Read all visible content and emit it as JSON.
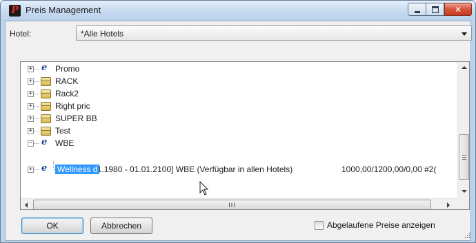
{
  "window": {
    "title": "Preis Management",
    "app_icon_letter": "P",
    "close_glyph": "✕"
  },
  "hotel": {
    "label": "Hotel:",
    "selected": "*Alle Hotels"
  },
  "tree": {
    "items": [
      {
        "label": "Promo",
        "icon": "ie-e-icon",
        "expander": "+"
      },
      {
        "label": "RACK",
        "icon": "package-icon",
        "expander": "+"
      },
      {
        "label": "Rack2",
        "icon": "package-icon",
        "expander": "+"
      },
      {
        "label": "Right pric",
        "icon": "package-icon",
        "expander": "+"
      },
      {
        "label": "SUPER BB",
        "icon": "package-icon",
        "expander": "+"
      },
      {
        "label": "Test",
        "icon": "package-icon",
        "expander": "+"
      },
      {
        "label": "WBE",
        "icon": "ie-e-icon",
        "expander": "−"
      },
      {
        "label": "Wellness d",
        "icon": "ie-e-icon",
        "expander": "+",
        "selected": true
      }
    ],
    "child": {
      "text": "[01.01.1980 - 01.01.2100] WBE  (Verfügbar in allen Hotels)",
      "prices": "1000,00/1200,00/0,00 #2("
    },
    "hscroll_grip": "III"
  },
  "buttons": {
    "ok": "OK",
    "cancel": "Abbrechen"
  },
  "checkbox": {
    "label": "Abgelaufene Preise anzeigen",
    "checked": false
  }
}
